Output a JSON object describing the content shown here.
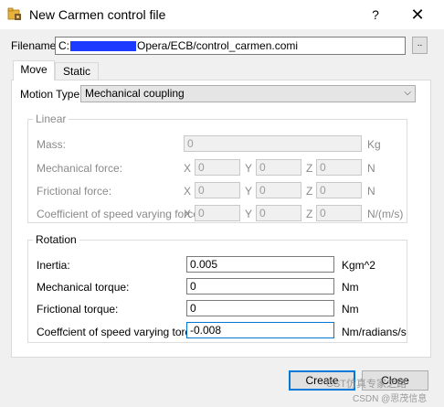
{
  "window": {
    "title": "New Carmen control file",
    "help": "?",
    "close": "✕",
    "icon": "folder-lock-icon"
  },
  "filename": {
    "label": "Filename:",
    "prefix": "C:",
    "suffix": "Opera/ECB/control_carmen.comi",
    "browse": ".."
  },
  "tabs": [
    {
      "label": "Move",
      "selected": true
    },
    {
      "label": "Static",
      "selected": false
    }
  ],
  "motion": {
    "label": "Motion Type:",
    "value": "Mechanical coupling"
  },
  "linear": {
    "title": "Linear",
    "mass": {
      "label": "Mass:",
      "value": "0",
      "unit": "Kg"
    },
    "rows": [
      {
        "label": "Mechanical force:",
        "x": "0",
        "y": "0",
        "z": "0",
        "unit": "N"
      },
      {
        "label": "Frictional force:",
        "x": "0",
        "y": "0",
        "z": "0",
        "unit": "N"
      },
      {
        "label": "Coefficient of speed varying force:",
        "x": "0",
        "y": "0",
        "z": "0",
        "unit": "N/(m/s)"
      }
    ],
    "axis_x": "X",
    "axis_y": "Y",
    "axis_z": "Z"
  },
  "rotation": {
    "title": "Rotation",
    "rows": [
      {
        "label": "Inertia:",
        "value": "0.005",
        "unit": "Kgm^2"
      },
      {
        "label": "Mechanical torque:",
        "value": "0",
        "unit": "Nm"
      },
      {
        "label": "Frictional torque:",
        "value": "0",
        "unit": "Nm"
      },
      {
        "label": "Coeffcient of speed varying torque:",
        "value": "-0.008",
        "unit": "Nm/radians/s"
      }
    ]
  },
  "buttons": {
    "create": "Create",
    "close": "Close"
  },
  "watermark": {
    "line1": "CST仿真专家之路",
    "line2": "CSDN @思茂信息"
  }
}
